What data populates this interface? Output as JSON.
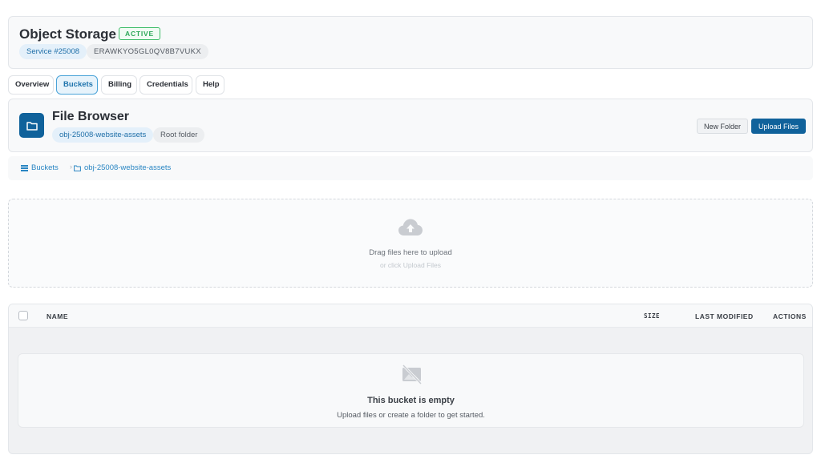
{
  "header": {
    "title": "Object Storage",
    "status": "ACTIVE",
    "service_id": "Service #25008",
    "access_key": "ERAWKYO5GL0QV8B7VUKX"
  },
  "tabs": [
    {
      "label": "Overview",
      "active": false
    },
    {
      "label": "Buckets",
      "active": true
    },
    {
      "label": "Billing",
      "active": false
    },
    {
      "label": "Credentials",
      "active": false
    },
    {
      "label": "Help",
      "active": false
    }
  ],
  "file_browser": {
    "title": "File Browser",
    "bucket": "obj-25008-website-assets",
    "location": "Root folder",
    "new_folder_label": "New Folder",
    "upload_label": "Upload Files",
    "icon": "folder-icon"
  },
  "breadcrumb": {
    "root": "Buckets",
    "current": "obj-25008-website-assets",
    "separator": "›"
  },
  "dropzone": {
    "main_text": "Drag files here to upload",
    "sub_text": "or click Upload Files",
    "icon": "cloud-upload-icon"
  },
  "table": {
    "columns": {
      "name": "NAME",
      "size": "SIZE",
      "last_modified": "LAST MODIFIED",
      "actions": "ACTIONS"
    },
    "empty_title": "This bucket is empty",
    "empty_subtitle": "Upload files or create a folder to get started.",
    "empty_icon": "no-image-icon"
  },
  "colors": {
    "primary": "#10629b",
    "link": "#2a86c3",
    "active_badge": "#2fa85a",
    "tab_active_border": "#4aa3d8"
  }
}
